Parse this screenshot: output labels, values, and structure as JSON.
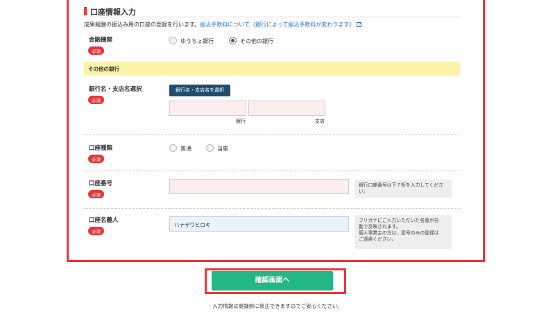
{
  "form": {
    "section_title": "口座情報入力",
    "description_text": "成果報酬の振込み用の口座の登録を行います。",
    "description_link": "振込手数料について（銀行によって振込手数料が変わります）",
    "required_badge": "必須",
    "institution": {
      "label": "金融機関",
      "options": [
        {
          "label": "ゆうちょ銀行",
          "selected": false
        },
        {
          "label": "その他の銀行",
          "selected": true
        }
      ]
    },
    "other_bank_header": "その他の銀行",
    "bank_branch": {
      "label": "銀行名・支店名選択",
      "select_button": "銀行名・支店名を選択",
      "bank_caption": "銀行",
      "branch_caption": "支店"
    },
    "account_type": {
      "label": "口座種類",
      "options": [
        {
          "label": "普通",
          "selected": false
        },
        {
          "label": "当座",
          "selected": false
        }
      ]
    },
    "account_number": {
      "label": "口座番号",
      "value": "",
      "help": "銀行口座番号は下７桁を入力してください。"
    },
    "account_holder": {
      "label": "口座名義人",
      "value": "ハナザワヒロキ",
      "help_lines": [
        "フリガナにご入力いただいた名義が自",
        "動で反映されます。",
        "個人事業主の方は、屋号のみの登録は",
        "ご遠慮ください。"
      ]
    }
  },
  "actions": {
    "confirm_label": "確認画面へ",
    "note": "入力情報は登録前に修正できますのでご安心ください。"
  },
  "colors": {
    "highlight_outline": "#e8353a",
    "confirm_button": "#22b784",
    "select_button": "#1e4d6e",
    "subheader_bg": "#fbf3a8"
  }
}
